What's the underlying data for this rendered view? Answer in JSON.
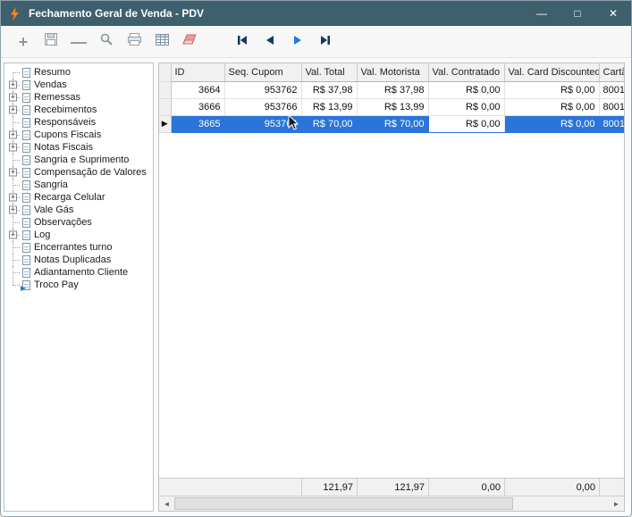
{
  "window": {
    "title": "Fechamento Geral de Venda - PDV",
    "controls": {
      "minimize": "—",
      "maximize": "□",
      "close": "✕"
    }
  },
  "toolbar": {
    "add_glyph": "+",
    "remove_glyph": "—",
    "icons": [
      "add-icon",
      "save-icon",
      "remove-icon",
      "search-icon",
      "print-icon",
      "table-icon",
      "eraser-icon",
      "nav-first-icon",
      "nav-prev-icon",
      "nav-next-icon",
      "nav-last-icon"
    ]
  },
  "tree": {
    "expand_glyph": "+",
    "items": [
      {
        "label": "Resumo",
        "expandable": false
      },
      {
        "label": "Vendas",
        "expandable": true
      },
      {
        "label": "Remessas",
        "expandable": true
      },
      {
        "label": "Recebimentos",
        "expandable": true
      },
      {
        "label": "Responsáveis",
        "expandable": false
      },
      {
        "label": "Cupons Fiscais",
        "expandable": true
      },
      {
        "label": "Notas Fiscais",
        "expandable": true
      },
      {
        "label": "Sangria e Suprimento",
        "expandable": false
      },
      {
        "label": "Compensação de Valores",
        "expandable": true
      },
      {
        "label": "Sangria",
        "expandable": false
      },
      {
        "label": "Recarga Celular",
        "expandable": true
      },
      {
        "label": "Vale Gás",
        "expandable": true
      },
      {
        "label": "Observações",
        "expandable": false
      },
      {
        "label": "Log",
        "expandable": true
      },
      {
        "label": "Encerrantes turno",
        "expandable": false
      },
      {
        "label": "Notas Duplicadas",
        "expandable": false
      },
      {
        "label": "Adiantamento Cliente",
        "expandable": false
      },
      {
        "label": "Troco Pay",
        "expandable": false
      }
    ]
  },
  "grid": {
    "row_indicator": "▶",
    "columns": [
      "ID",
      "Seq. Cupom",
      "Val. Total",
      "Val. Motorista",
      "Val. Contratado",
      "Val. Card Discounted",
      "Cartã"
    ],
    "rows": [
      {
        "cells": [
          "3664",
          "953762",
          "R$ 37,98",
          "R$ 37,98",
          "R$ 0,00",
          "R$ 0,00",
          "8001"
        ],
        "selected": false
      },
      {
        "cells": [
          "3666",
          "953766",
          "R$ 13,99",
          "R$ 13,99",
          "R$ 0,00",
          "R$ 0,00",
          "8001"
        ],
        "selected": false
      },
      {
        "cells": [
          "3665",
          "953764",
          "R$ 70,00",
          "R$ 70,00",
          "R$ 0,00",
          "R$ 0,00",
          "8001"
        ],
        "selected": true
      }
    ],
    "totals": {
      "val_total": "121,97",
      "val_motorista": "121,97",
      "val_contratado": "0,00",
      "val_card_discounted": "0,00"
    }
  },
  "scrollbar": {
    "left_glyph": "◄",
    "right_glyph": "►"
  },
  "colors": {
    "titlebar": "#3d5f6e",
    "selection": "#2b74d9",
    "selection_text": "#ffffff",
    "grid_header_bg": "#f1f1f1",
    "nav_arrow": "#17375e",
    "nav_arrow_active": "#1e7be0",
    "eraser": "#ef9a9a",
    "app_icon": "#f08c2e"
  }
}
